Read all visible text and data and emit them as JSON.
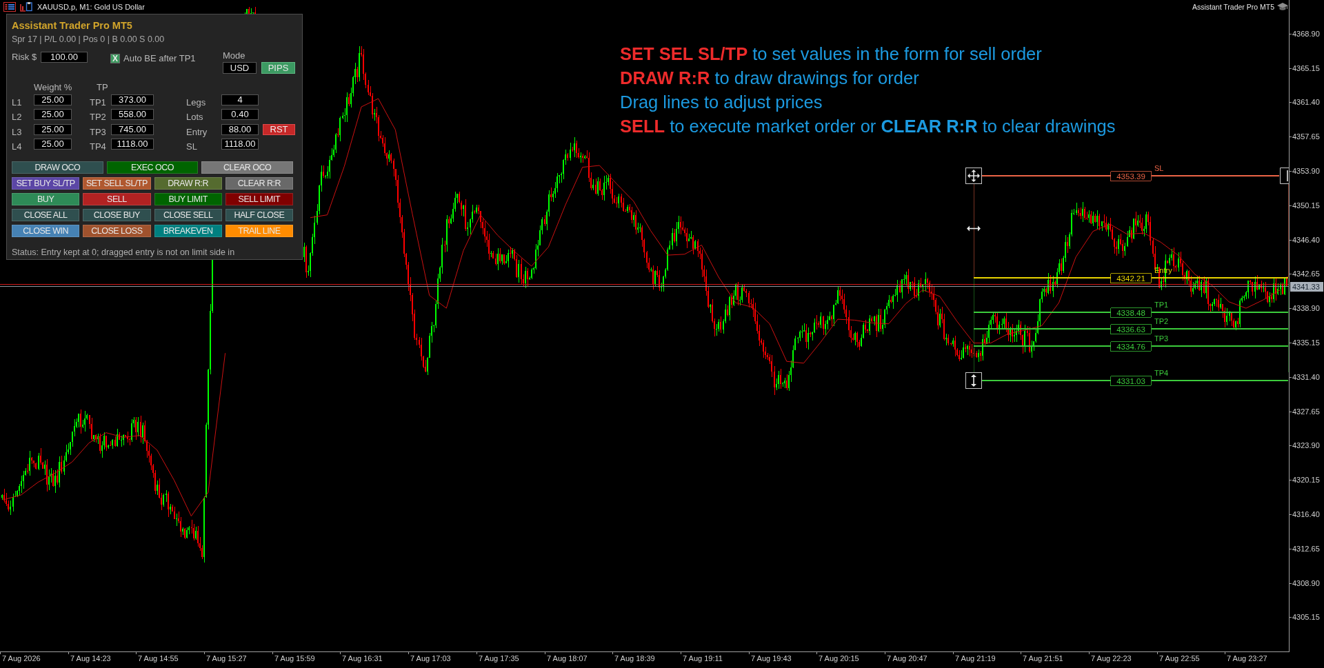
{
  "chart": {
    "symbol": "XAUUSD.p, M1: Gold US Dollar",
    "corner_label": "Assistant Trader Pro MT5",
    "chart_data": {
      "type": "line",
      "categories": [
        null,
        "7 Aug 2026",
        null,
        null,
        null,
        "7 Aug 14:23",
        null,
        null,
        null,
        "7 Aug 14:55",
        null,
        null,
        null,
        "7 Aug 15:27",
        null,
        null,
        null,
        "7 Aug 15:59",
        null,
        null,
        null,
        "7 Aug 16:31",
        null,
        null,
        null,
        "7 Aug 17:03",
        null,
        null,
        null,
        "7 Aug 17:35",
        null,
        null,
        null,
        "7 Aug 18:07",
        null,
        null,
        null,
        "7 Aug 18:39",
        null,
        null,
        null,
        "7 Aug 19:11",
        null,
        null,
        null,
        "7 Aug 19:43",
        null,
        null,
        null,
        "7 Aug 20:15",
        null,
        null,
        null,
        "7 Aug 20:47",
        null,
        null,
        null,
        "7 Aug 21:19",
        null,
        null,
        null,
        "7 Aug 21:51",
        null,
        null,
        null,
        "7 Aug 22:23",
        null,
        null,
        null,
        "7 Aug 22:55",
        null,
        null,
        null,
        "7 Aug 23:27",
        null,
        null
      ],
      "series": [
        {
          "color": "#cc1111",
          "values": [
            4318.0,
            4318.5,
            4319.9,
            4320.9,
            4322.1,
            4324.2,
            4325.3,
            4324.8,
            4325.0,
            4323.4,
            4320.1,
            4316.2,
            4318.8,
            4334.0,
            null,
            null,
            null,
            null,
            4348.8,
            4349.1,
            4354.4,
            4360.9,
            4361.8,
            4358.4,
            4349.2,
            4340.3,
            4338.9,
            4345.2,
            4349.1,
            4346.9,
            4345.1,
            4343.5,
            4345.6,
            4350.2,
            4354.3,
            4354.5,
            4352.5,
            4350.6,
            4347.4,
            4344.7,
            4344.8,
            4345.8,
            4342.3,
            4339.5,
            4339.0,
            4337.2,
            4333.1,
            4332.9,
            4335.2,
            4337.7,
            4337.6,
            4337.3,
            4337.2,
            4339.4,
            4340.9,
            4340.2,
            4337.5,
            4335.1,
            4335.1,
            4336.1,
            4336.5,
            4337.0,
            4339.5,
            4344.5,
            4347.3,
            4348.1,
            4347.0,
            4347.1,
            4346.1,
            4344.7,
            4342.6,
            4341.4,
            4339.6,
            4338.9,
            4339.8,
            4340.9
          ]
        }
      ],
      "ylim": [
        4301.41,
        4372.42
      ],
      "yticks": [
        {
          "value": 4368.9,
          "label": "4368.90"
        },
        {
          "value": 4365.15,
          "label": "4365.15"
        },
        {
          "value": 4361.4,
          "label": "4361.40"
        },
        {
          "value": 4357.65,
          "label": "4357.65"
        },
        {
          "value": 4353.9,
          "label": "4353.90"
        },
        {
          "value": 4350.15,
          "label": "4350.15"
        },
        {
          "value": 4346.4,
          "label": "4346.40"
        },
        {
          "value": 4342.65,
          "label": "4342.65"
        },
        {
          "value": 4338.9,
          "label": "4338.90"
        },
        {
          "value": 4335.15,
          "label": "4335.15"
        },
        {
          "value": 4331.4,
          "label": "4331.40"
        },
        {
          "value": 4327.65,
          "label": "4327.65"
        },
        {
          "value": 4323.9,
          "label": "4323.90"
        },
        {
          "value": 4320.15,
          "label": "4320.15"
        },
        {
          "value": 4316.4,
          "label": "4316.40"
        },
        {
          "value": 4312.65,
          "label": "4312.65"
        },
        {
          "value": 4308.9,
          "label": "4308.90"
        },
        {
          "value": 4305.15,
          "label": "4305.15"
        }
      ]
    },
    "current_price": "4341.33",
    "trade_levels": [
      {
        "kind": "sl",
        "label": "SL",
        "price": "4353.39",
        "color": "#ec6446"
      },
      {
        "kind": "entry",
        "label": "Entry",
        "price": "4342.21",
        "color": "#e8d400"
      },
      {
        "kind": "tp",
        "label": "TP1",
        "price": "4338.48",
        "color": "#3ccc3c"
      },
      {
        "kind": "tp",
        "label": "TP2",
        "price": "4336.63",
        "color": "#3ccc3c"
      },
      {
        "kind": "tp",
        "label": "TP3",
        "price": "4334.76",
        "color": "#3ccc3c"
      },
      {
        "kind": "tp",
        "label": "TP4",
        "price": "4331.03",
        "color": "#3ccc3c"
      }
    ],
    "instructions": [
      {
        "segments": [
          {
            "text": "SET SEL SL/TP",
            "bold": true,
            "color": "#ee2b2b"
          },
          {
            "text": "to set values in the form for sell order",
            "bold": false,
            "color": "#1c9ae0"
          }
        ]
      },
      {
        "segments": [
          {
            "text": "DRAW R:R",
            "bold": true,
            "color": "#ee2b2b"
          },
          {
            "text": "to draw drawings for order",
            "bold": false,
            "color": "#1c9ae0"
          }
        ]
      },
      {
        "segments": [
          {
            "text": "Drag lines to adjust prices",
            "bold": false,
            "color": "#1c9ae0"
          }
        ]
      },
      {
        "segments": [
          {
            "text": "SELL",
            "bold": true,
            "color": "#ee2b2b"
          },
          {
            "text": "to execute market order or",
            "bold": false,
            "color": "#1c9ae0"
          },
          {
            "text": "CLEAR R:R",
            "bold": true,
            "color": "#1c9ae0"
          },
          {
            "text": "to clear drawings",
            "bold": false,
            "color": "#1c9ae0"
          }
        ]
      }
    ]
  },
  "panel": {
    "title": "Assistant Trader Pro MT5",
    "stats": "Spr 17 | P/L 0.00 | Pos 0 | B 0.00 S 0.00",
    "risk": {
      "label": "Risk $",
      "value": "100.00"
    },
    "auto_be": {
      "label": "Auto BE after TP1",
      "mark": "X",
      "checked": true
    },
    "mode": {
      "label": "Mode",
      "options": [
        {
          "label": "USD",
          "selected": false
        },
        {
          "label": "PIPS",
          "selected": true
        }
      ]
    },
    "weight_header": "Weight %",
    "tp_header": "TP",
    "legs": [
      {
        "label": "L1",
        "weight": "25.00",
        "tp_label": "TP1",
        "tp": "373.00"
      },
      {
        "label": "L2",
        "weight": "25.00",
        "tp_label": "TP2",
        "tp": "558.00"
      },
      {
        "label": "L3",
        "weight": "25.00",
        "tp_label": "TP3",
        "tp": "745.00"
      },
      {
        "label": "L4",
        "weight": "25.00",
        "tp_label": "TP4",
        "tp": "1118.00"
      }
    ],
    "settings": [
      {
        "label": "Legs",
        "value": "4"
      },
      {
        "label": "Lots",
        "value": "0.40"
      },
      {
        "label": "Entry",
        "value": "88.00"
      },
      {
        "label": "SL",
        "value": "1118.00"
      }
    ],
    "side_button": "RST",
    "button_rows": [
      {
        "buttons": [
          {
            "label": "DRAW OCO",
            "color": "#2f4f4f"
          },
          {
            "label": "EXEC OCO",
            "color": "#006400"
          },
          {
            "label": "CLEAR OCO",
            "color": "#777777"
          }
        ]
      },
      {
        "buttons": [
          {
            "label": "SET BUY SL/TP",
            "color": "#5b46a6"
          },
          {
            "label": "SET SELL SL/TP",
            "color": "#b0582f"
          },
          {
            "label": "DRAW R:R",
            "color": "#556b2f"
          },
          {
            "label": "CLEAR R:R",
            "color": "#696969"
          }
        ]
      },
      {
        "buttons": [
          {
            "label": "BUY",
            "color": "#2e8b57"
          },
          {
            "label": "SELL",
            "color": "#b22222"
          },
          {
            "label": "BUY LIMIT",
            "color": "#006400"
          },
          {
            "label": "SELL LIMIT",
            "color": "#800000"
          }
        ]
      },
      {
        "buttons": [
          {
            "label": "CLOSE ALL",
            "color": "#2f4f4f"
          },
          {
            "label": "CLOSE BUY",
            "color": "#2f4f4f"
          },
          {
            "label": "CLOSE SELL",
            "color": "#2f4f4f"
          },
          {
            "label": "HALF CLOSE",
            "color": "#2f4f4f"
          }
        ]
      },
      {
        "buttons": [
          {
            "label": "CLOSE WIN",
            "color": "#4682b4"
          },
          {
            "label": "CLOSE LOSS",
            "color": "#a0522d"
          },
          {
            "label": "BREAKEVEN",
            "color": "#008080"
          },
          {
            "label": "TRAIL LINE",
            "color": "#ff8c00"
          }
        ]
      }
    ],
    "status": "Status: Entry kept at 0; dragged entry is not on limit side in"
  }
}
